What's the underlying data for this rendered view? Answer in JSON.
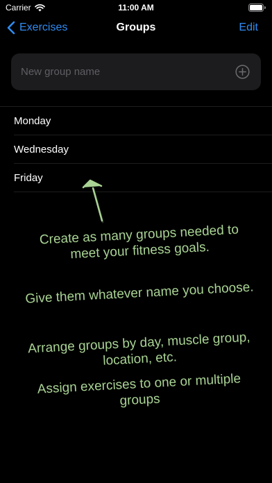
{
  "status_bar": {
    "carrier": "Carrier",
    "time": "11:00 AM",
    "wifi_icon": "wifi-icon",
    "battery_icon": "battery-icon"
  },
  "nav": {
    "back_label": "Exercises",
    "back_icon": "chevron-left-icon",
    "title": "Groups",
    "edit_label": "Edit"
  },
  "new_group": {
    "placeholder": "New group name",
    "value": "",
    "add_icon": "plus-circle-icon"
  },
  "groups": [
    {
      "label": "Monday"
    },
    {
      "label": "Wednesday"
    },
    {
      "label": "Friday"
    }
  ],
  "annotation": {
    "arrow_icon": "arrow-up-icon",
    "lines": [
      "Create as many groups needed to meet your fitness goals.",
      "Give them whatever name you choose.",
      "Arrange groups by day, muscle group, location, etc.",
      "Assign exercises to one or multiple groups"
    ]
  },
  "colors": {
    "background": "#000000",
    "accent": "#2f8cf4",
    "field_background": "#1c1c1e",
    "annotation": "#a9d394"
  }
}
